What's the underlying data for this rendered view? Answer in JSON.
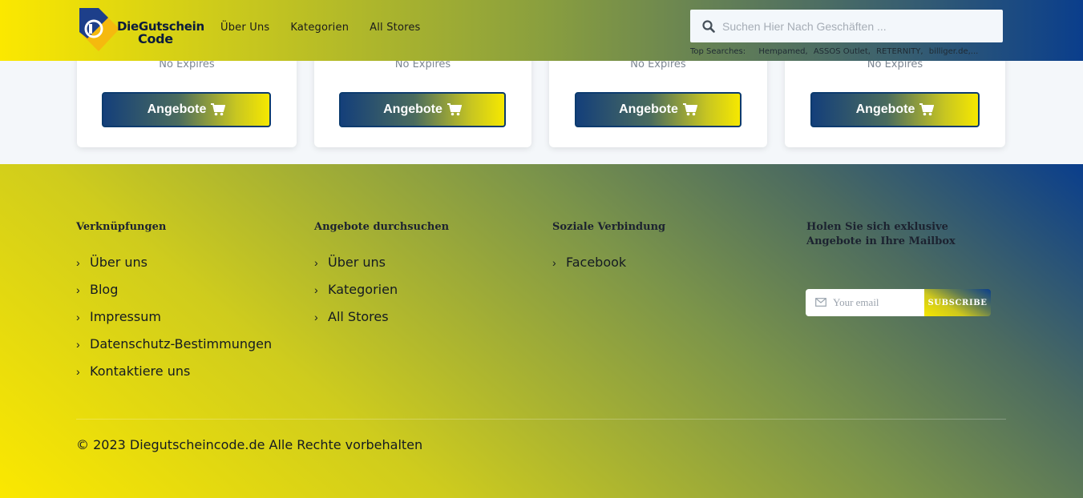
{
  "header": {
    "logo": {
      "line1": "DieGutschein",
      "line2": "Code"
    },
    "nav": [
      "Über Uns",
      "Kategorien",
      "All Stores"
    ],
    "search_placeholder": "Suchen Hier Nach Geschäften ...",
    "top_searches_label": "Top Searches:",
    "top_searches": [
      "Hempamed,",
      "ASSOS Outlet,",
      "RETERNITY,",
      "billiger.de,..."
    ]
  },
  "cards": [
    {
      "expires": "No Expires",
      "button_label": "Angebote"
    },
    {
      "expires": "No Expires",
      "button_label": "Angebote"
    },
    {
      "expires": "No Expires",
      "button_label": "Angebote"
    },
    {
      "expires": "No Expires",
      "button_label": "Angebote"
    }
  ],
  "footer": {
    "col1": {
      "title": "Verknüpfungen",
      "links": [
        "Über uns",
        "Blog",
        "Impressum",
        "Datenschutz-Bestimmungen",
        "Kontaktiere uns"
      ]
    },
    "col2": {
      "title": "Angebote durchsuchen",
      "links": [
        "Über uns",
        "Kategorien",
        "All Stores"
      ]
    },
    "col3": {
      "title": "Soziale Verbindung",
      "links": [
        "Facebook"
      ]
    },
    "col4": {
      "title": "Holen Sie sich exklusive Angebote in Ihre Mailbox"
    },
    "newsletter": {
      "email_placeholder": "Your email",
      "subscribe_label": "SUBSCRIBE"
    },
    "copyright": "© 2023 Diegutscheincode.de Alle Rechte vorbehalten"
  },
  "colors": {
    "brand_yellow": "#fbe800",
    "brand_blue": "#0a3e8c",
    "button_border": "#0c3b6e"
  },
  "icons": {
    "search": "search-icon",
    "cart": "shopping-cart-icon",
    "chevron": "chevron-right-icon",
    "email": "envelope-icon"
  }
}
